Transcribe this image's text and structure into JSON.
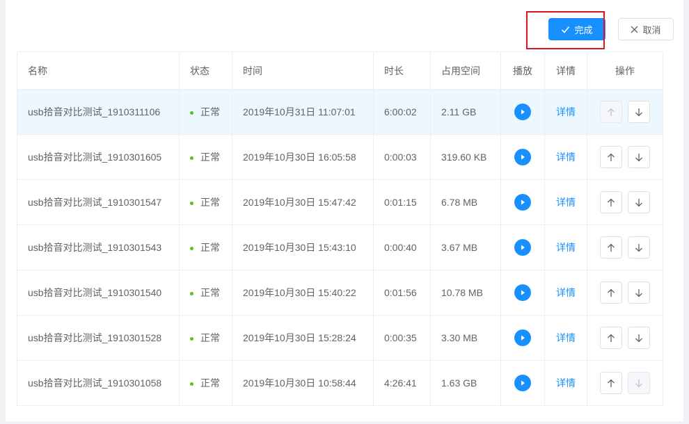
{
  "toolbar": {
    "done_label": "完成",
    "cancel_label": "取消"
  },
  "table": {
    "headers": {
      "name": "名称",
      "status": "状态",
      "time": "时间",
      "duration": "时长",
      "size": "占用空间",
      "play": "播放",
      "detail": "详情",
      "ops": "操作"
    },
    "rows": [
      {
        "name": "usb拾音对比测试_1910311106",
        "status": "正常",
        "time": "2019年10月31日 11:07:01",
        "duration": "6:00:02",
        "size": "2.11 GB",
        "detail": "详情"
      },
      {
        "name": "usb拾音对比测试_1910301605",
        "status": "正常",
        "time": "2019年10月30日 16:05:58",
        "duration": "0:00:03",
        "size": "319.60 KB",
        "detail": "详情"
      },
      {
        "name": "usb拾音对比测试_1910301547",
        "status": "正常",
        "time": "2019年10月30日 15:47:42",
        "duration": "0:01:15",
        "size": "6.78 MB",
        "detail": "详情"
      },
      {
        "name": "usb拾音对比测试_1910301543",
        "status": "正常",
        "time": "2019年10月30日 15:43:10",
        "duration": "0:00:40",
        "size": "3.67 MB",
        "detail": "详情"
      },
      {
        "name": "usb拾音对比测试_1910301540",
        "status": "正常",
        "time": "2019年10月30日 15:40:22",
        "duration": "0:01:56",
        "size": "10.78 MB",
        "detail": "详情"
      },
      {
        "name": "usb拾音对比测试_1910301528",
        "status": "正常",
        "time": "2019年10月30日 15:28:24",
        "duration": "0:00:35",
        "size": "3.30 MB",
        "detail": "详情"
      },
      {
        "name": "usb拾音对比测试_1910301058",
        "status": "正常",
        "time": "2019年10月30日 10:58:44",
        "duration": "4:26:41",
        "size": "1.63 GB",
        "detail": "详情"
      }
    ]
  },
  "colors": {
    "accent": "#1890ff",
    "status_ok": "#52c41a",
    "highlight_box": "#e0141e",
    "active_row": "#ecf7fe"
  },
  "icons": [
    "check-icon",
    "close-icon",
    "play-icon",
    "arrow-up-icon",
    "arrow-down-icon"
  ]
}
